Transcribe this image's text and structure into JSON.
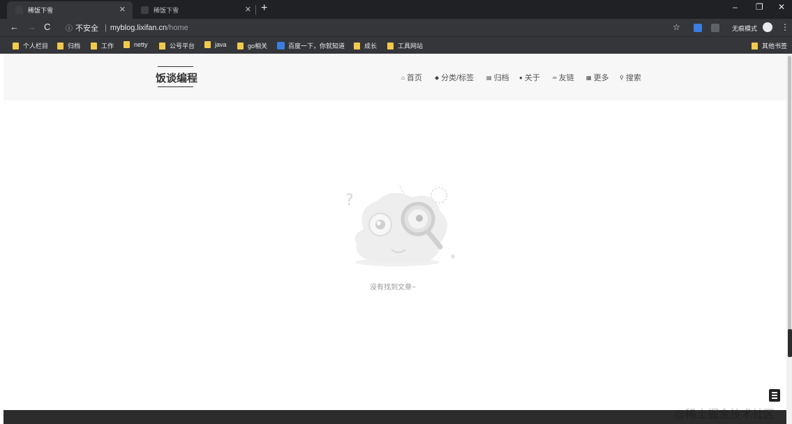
{
  "browser": {
    "tabs": [
      {
        "title": "稀饭下雪",
        "active": true
      },
      {
        "title": "稀饭下雪",
        "active": false
      }
    ],
    "window_controls": [
      "–",
      "❐",
      "✕"
    ],
    "address": {
      "security": "不安全",
      "host": "myblog.lixifan.cn",
      "path": "/home"
    },
    "incognito_label": "无痕模式",
    "bookmarks": [
      {
        "label": "个人栏目",
        "icon": "folder-icon"
      },
      {
        "label": "归档",
        "icon": "folder-icon"
      },
      {
        "label": "工作",
        "icon": "folder-icon"
      },
      {
        "label": "netty",
        "icon": "folder-icon"
      },
      {
        "label": "公号平台",
        "icon": "folder-icon"
      },
      {
        "label": "java",
        "icon": "folder-icon"
      },
      {
        "label": "go相关",
        "icon": "folder-icon"
      },
      {
        "label": "百度一下，你就知道",
        "icon": "baidu-icon"
      },
      {
        "label": "成长",
        "icon": "folder-icon"
      },
      {
        "label": "工具网站",
        "icon": "folder-icon"
      }
    ],
    "other_bookmarks": "其他书签"
  },
  "site": {
    "brand": "饭谈编程",
    "nav": [
      {
        "icon": "home-icon",
        "glyph": "⌂",
        "label": "首页"
      },
      {
        "icon": "tag-icon",
        "glyph": "◆",
        "label": "分类/标签"
      },
      {
        "icon": "archive-icon",
        "glyph": "▤",
        "label": "归档"
      },
      {
        "icon": "user-icon",
        "glyph": "●",
        "label": "关于"
      },
      {
        "icon": "link-icon",
        "glyph": "∞",
        "label": "友链"
      },
      {
        "icon": "grid-icon",
        "glyph": "▦",
        "label": "更多"
      },
      {
        "icon": "search-icon",
        "glyph": "⚲",
        "label": "搜索"
      }
    ],
    "empty_message": "没有找到文章~"
  },
  "watermark": "@稀土掘金技术社区"
}
